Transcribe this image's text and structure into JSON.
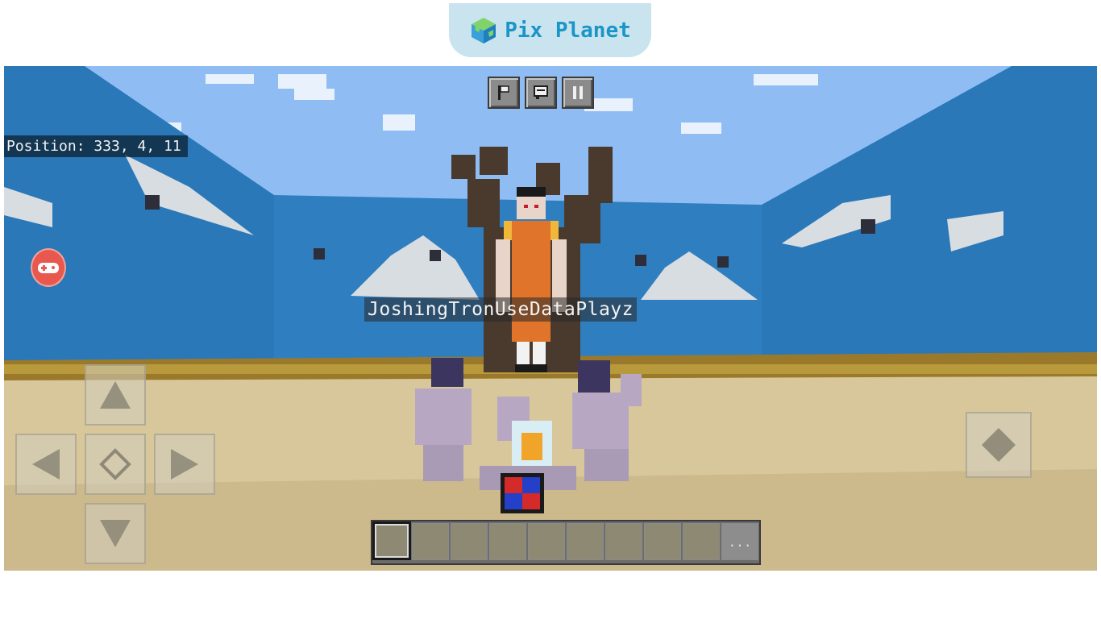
{
  "banner": {
    "brand": "Pix Planet"
  },
  "hud": {
    "position_text": "Position: 333, 4, 11",
    "buttons": [
      {
        "name": "emote-menu",
        "icon": "flag-icon"
      },
      {
        "name": "chat",
        "icon": "chat-icon"
      },
      {
        "name": "pause",
        "icon": "pause-icon"
      }
    ]
  },
  "player": {
    "nametag": "JoshingTronUseDataPlayz"
  },
  "controls": {
    "dpad": [
      "up",
      "left",
      "center",
      "right",
      "down"
    ],
    "jump_icon": "diamond-icon"
  },
  "hotbar": {
    "slot_count": 9,
    "selected_slot": 1,
    "more_label": "..."
  },
  "colors": {
    "sky": "#5f9be8",
    "wall": "#2f7fc0",
    "sand": "#d8c79b",
    "brand": "#1b95c7",
    "doll_dress": "#e0742a"
  }
}
